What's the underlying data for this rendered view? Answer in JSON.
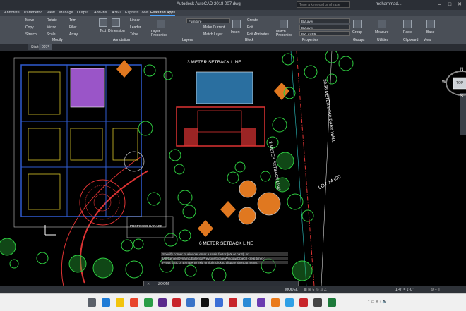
{
  "window": {
    "title": "Autodesk AutoCAD 2018    007.dwg",
    "search_placeholder": "Type a keyword or phrase",
    "user": "mohammad..."
  },
  "menu_tabs": [
    "Annotate",
    "Parametric",
    "View",
    "Manage",
    "Output",
    "Add-ins",
    "A360",
    "Express Tools",
    "Featured Apps"
  ],
  "ribbon": {
    "draw_buttons": [
      "Move",
      "Copy",
      "Stretch",
      "Rotate",
      "Mirror",
      "Scale",
      "Trim",
      "Fillet",
      "Array"
    ],
    "annotation_buttons": [
      "Text",
      "Dimension",
      "Linear",
      "Leader",
      "Table"
    ],
    "layers_button": "Layer Properties",
    "layer_dropdown": "Furniture",
    "block_buttons": [
      "Insert",
      "Create",
      "Edit",
      "Edit Attributes",
      "Make Current",
      "Match Layer"
    ],
    "match_properties": "Match Properties",
    "props": [
      "ByLayer",
      "ByLayer",
      "BYLAYER"
    ],
    "right_buttons": [
      "Group",
      "Measure",
      "Paste",
      "Base"
    ],
    "panels": [
      "Modify",
      "Annotation",
      "Layers",
      "Block",
      "Properties",
      "Groups",
      "Utilities",
      "Clipboard",
      "View"
    ]
  },
  "doc_tabs": [
    "Start",
    "007*"
  ],
  "drawing_labels": {
    "top_setback": "3 METER SETBACK LINE",
    "bottom_setback": "6 METER SETBACK LINE",
    "right_setback": "3 METER SETBACK LINE",
    "wall": "30.36 METER BOUNDARY WALL",
    "lot": "LOT 14350",
    "garage": "PROPOSED GARAGE"
  },
  "viewcube": {
    "top": "TOP",
    "w": "W",
    "s": "S",
    "n": "N"
  },
  "command": {
    "lines": [
      "Specify corner of window, enter a scale factor (nX or nXP), or",
      "[All/Center/Dynamic/Extents/Previous/Scale/Window/Object] <real time>:",
      "Press ESC or ENTER to exit, or right-click to display shortcut menu."
    ],
    "input": "ZOOM"
  },
  "status": {
    "model": "MODEL",
    "scale": "1'-0\" = 1'-0\""
  }
}
